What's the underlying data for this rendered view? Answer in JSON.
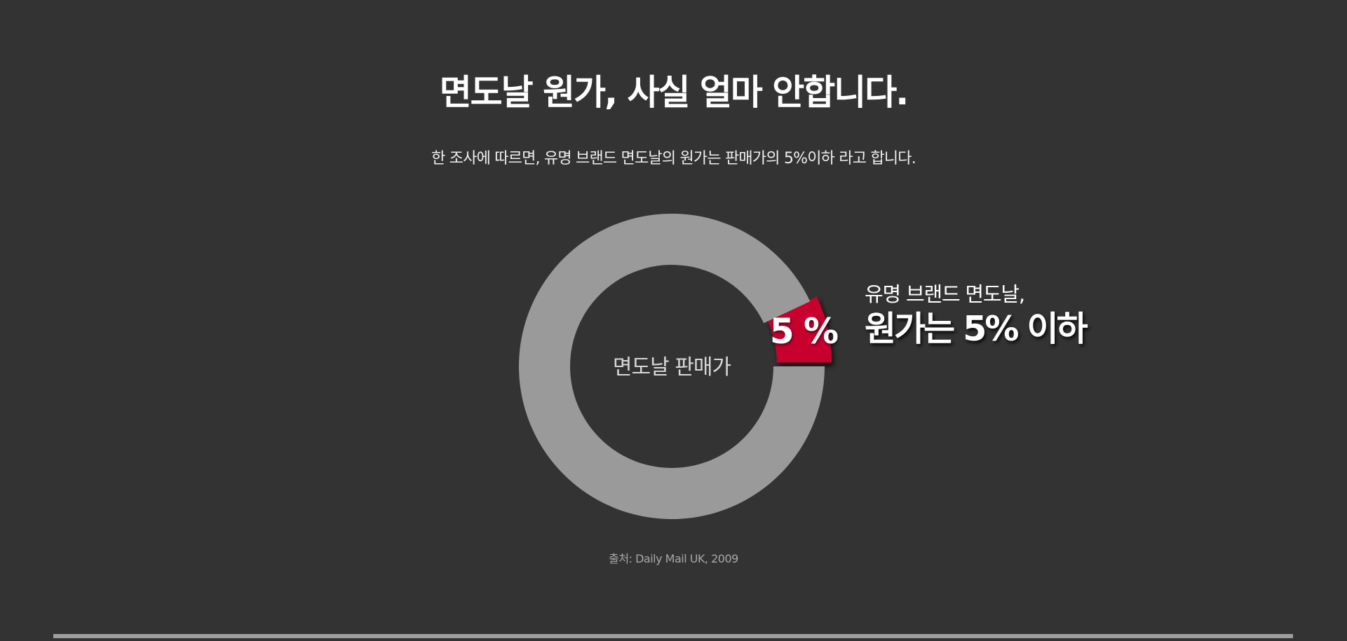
{
  "header": {
    "title": "면도날 원가, 사실 얼마 안합니다.",
    "subtitle": "한 조사에 따르면, 유명 브랜드 면도날의 원가는 판매가의 5%이하 라고 합니다."
  },
  "chart_data": {
    "type": "pie",
    "style": "donut",
    "center_label": "면도날 판매가",
    "slices": [
      {
        "label": "5 %",
        "value": 5,
        "color": "#c8002e",
        "exploded": true
      },
      {
        "label": "",
        "value": 95,
        "color": "#9a9a9a",
        "exploded": false
      }
    ],
    "callout": {
      "line1": "유명 브랜드 면도날,",
      "line2": "원가는 5% 이하"
    },
    "source": "출처: Daily Mail UK, 2009"
  },
  "colors": {
    "background": "#333333",
    "accent": "#c8002e",
    "ring": "#9a9a9a",
    "text": "#ffffff",
    "source_text": "#a8a8a8",
    "bottom_bar": "#9e9e9e"
  }
}
